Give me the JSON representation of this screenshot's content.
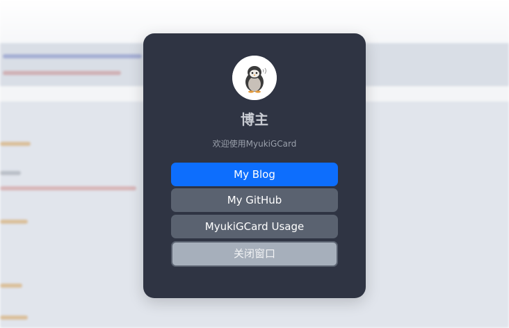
{
  "card": {
    "title": "博主",
    "subtitle": "欢迎使用MyukiGCard",
    "avatar_icon": "penguin-avatar-icon"
  },
  "buttons": {
    "blog": "My Blog",
    "github": "My GitHub",
    "usage": "MyukiGCard Usage",
    "close": "关闭窗口"
  },
  "colors": {
    "card_bg": "#2f3443",
    "primary": "#0d6efd",
    "secondary": "#5a6270",
    "close_bg": "#a6afbb"
  }
}
